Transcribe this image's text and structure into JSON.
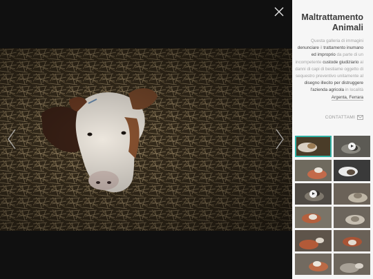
{
  "gallery": {
    "title_line1": "Maltrattamento",
    "title_line2": "Animali",
    "description": [
      {
        "t": "Questa galleria di immagini ",
        "s": "plain"
      },
      {
        "t": "denunciare",
        "s": "bold"
      },
      {
        "t": " il ",
        "s": "plain"
      },
      {
        "t": "trattamento inumano ed improprio",
        "s": "bold"
      },
      {
        "t": " da parte di un incompetente ",
        "s": "plain"
      },
      {
        "t": "custode giudiziario",
        "s": "bold"
      },
      {
        "t": " ai danni di capi di bestiame oggetto di sequestro preventivo unitamente al ",
        "s": "plain"
      },
      {
        "t": "disegno illecito per distruggere l'azienda agricola",
        "s": "bold"
      },
      {
        "t": " in località ",
        "s": "plain"
      },
      {
        "t": "Argenta, Ferrara",
        "s": "link"
      }
    ],
    "contact_label": "CONTATTAMI",
    "contact_icon": "envelope-icon",
    "close_icon": "close-icon",
    "prev_icon": "chevron-left-icon",
    "next_icon": "chevron-right-icon",
    "current_image": "Calf lying in straw",
    "accent_color": "#2fb0a3"
  },
  "thumbnails": [
    {
      "name": "calf-in-straw",
      "video": false,
      "active": true
    },
    {
      "name": "barn-video",
      "video": true,
      "active": false
    },
    {
      "name": "dead-cow-field",
      "video": false,
      "active": false
    },
    {
      "name": "cows-in-barn",
      "video": false,
      "active": false
    },
    {
      "name": "barn-video-2",
      "video": true,
      "active": false
    },
    {
      "name": "sheep-in-straw",
      "video": false,
      "active": false
    },
    {
      "name": "cow-lying-field",
      "video": false,
      "active": false
    },
    {
      "name": "sheep-pen",
      "video": false,
      "active": false
    },
    {
      "name": "cow-carcass",
      "video": false,
      "active": false
    },
    {
      "name": "cow-carcass-2",
      "video": false,
      "active": false
    },
    {
      "name": "cow-ground",
      "video": false,
      "active": false
    },
    {
      "name": "cow-ground-2",
      "video": false,
      "active": false
    }
  ]
}
